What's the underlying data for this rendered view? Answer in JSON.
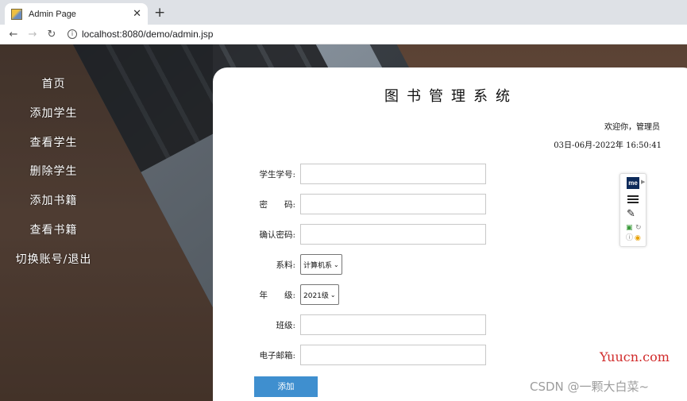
{
  "browser": {
    "tab_title": "Admin Page",
    "tab_close": "✕",
    "new_tab": "+",
    "back": "←",
    "forward": "→",
    "reload": "↻",
    "info": "i",
    "url_host": "localhost",
    "url_rest": ":8080/demo/admin.jsp"
  },
  "sidebar": {
    "items": [
      {
        "label": "首页"
      },
      {
        "label": "添加学生"
      },
      {
        "label": "查看学生"
      },
      {
        "label": "删除学生"
      },
      {
        "label": "添加书籍"
      },
      {
        "label": "查看书籍"
      },
      {
        "label": "切换账号/退出"
      }
    ]
  },
  "header": {
    "title": "图书管理系统",
    "welcome": "欢迎你，管理员",
    "datetime": "03日-06月-2022年 16:50:41"
  },
  "form": {
    "student_id_label": "学生学号:",
    "password_label": "密　　码:",
    "confirm_password_label": "确认密码:",
    "department_label": "系料:",
    "department_value": "计算机系",
    "grade_label": "年　　级:",
    "grade_value": "2021级",
    "class_label": "班级:",
    "email_label": "电子邮箱:",
    "submit_label": "添加"
  },
  "extension": {
    "me_label": "me"
  },
  "watermarks": {
    "site": "Yuucn.com",
    "csdn": "CSDN @一颗大白菜~"
  },
  "colors": {
    "button": "#3f8fcf",
    "watermark_red": "#d12b2b"
  }
}
